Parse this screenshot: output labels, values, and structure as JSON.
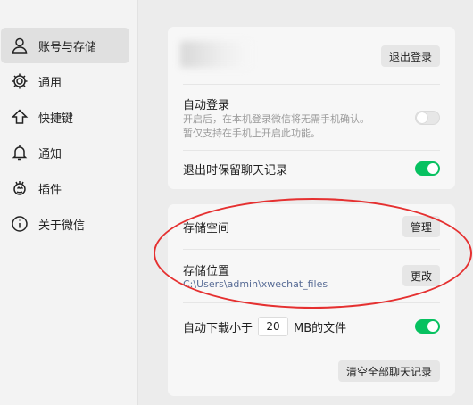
{
  "sidebar": {
    "items": [
      {
        "label": "账号与存储",
        "icon": "user-icon"
      },
      {
        "label": "通用",
        "icon": "gear-icon"
      },
      {
        "label": "快捷键",
        "icon": "keyboard-arrow-icon"
      },
      {
        "label": "通知",
        "icon": "bell-icon"
      },
      {
        "label": "插件",
        "icon": "plugin-icon"
      },
      {
        "label": "关于微信",
        "icon": "info-icon"
      }
    ]
  },
  "account": {
    "logout_label": "退出登录",
    "auto_login_title": "自动登录",
    "auto_login_hint_1": "开启后，在本机登录微信将无需手机确认。",
    "auto_login_hint_2": "暂仅支持在手机上开启此功能。",
    "keep_history_title": "退出时保留聊天记录"
  },
  "storage": {
    "space_title": "存储空间",
    "manage_label": "管理",
    "location_title": "存储位置",
    "location_path": "C:\\Users\\admin\\xwechat_files",
    "change_label": "更改",
    "auto_download_prefix": "自动下载小于",
    "auto_download_value": "20",
    "auto_download_suffix": "MB的文件",
    "clear_history_label": "清空全部聊天记录"
  },
  "colors": {
    "toggle_on": "#07c160",
    "annotation": "#e53030",
    "path_link": "#576b95"
  }
}
